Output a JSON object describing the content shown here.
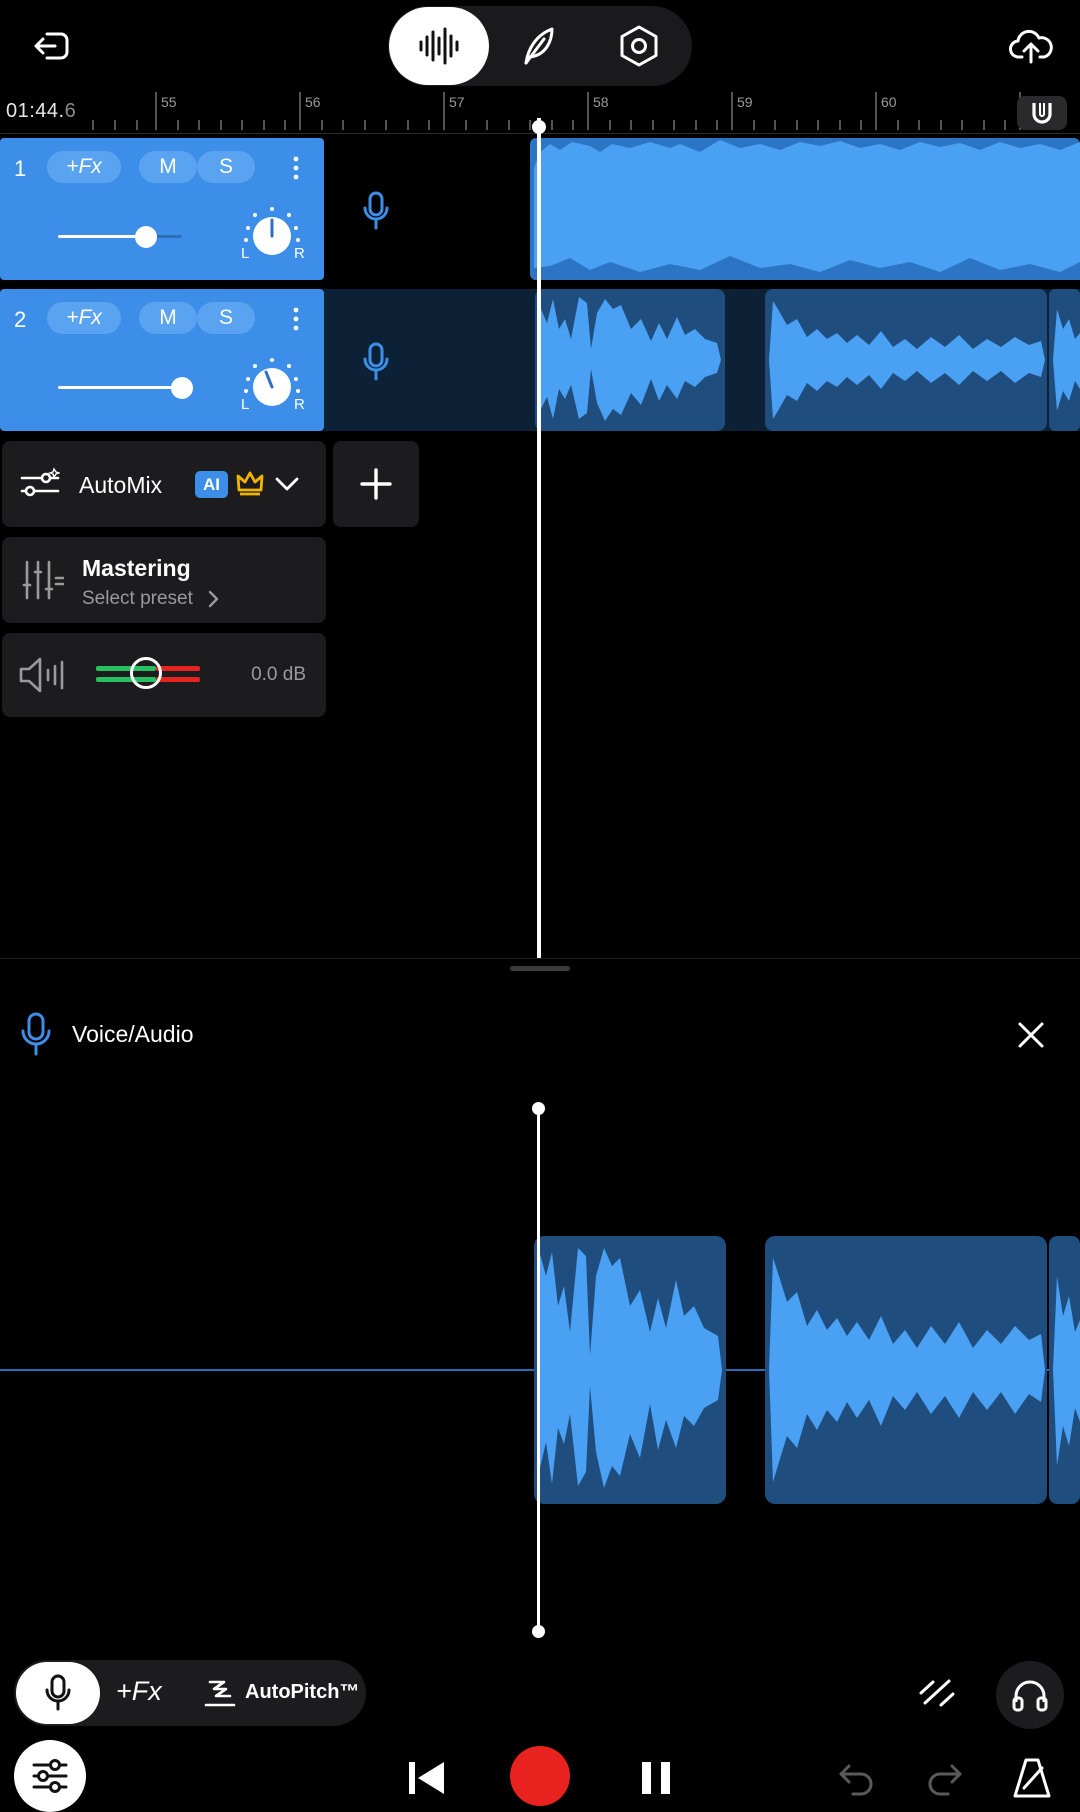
{
  "toolbar": {
    "icons": [
      "back-icon",
      "waveform-icon",
      "feather-icon",
      "settings-hex-icon",
      "cloud-upload-icon"
    ],
    "active_mode": "waveform"
  },
  "ruler": {
    "time_main": "01:44.",
    "time_tenth": "6",
    "marks": [
      "55",
      "56",
      "57",
      "58",
      "59",
      "60"
    ]
  },
  "tracks": [
    {
      "number": "1",
      "fx_label": "+Fx",
      "mute_label": "M",
      "solo_label": "S",
      "volume": 0.75,
      "pan_left": "L",
      "pan_right": "R"
    },
    {
      "number": "2",
      "fx_label": "+Fx",
      "mute_label": "M",
      "solo_label": "S",
      "volume": 1.0,
      "pan_left": "L",
      "pan_right": "R"
    }
  ],
  "automix": {
    "label": "AutoMix",
    "ai_badge": "AI"
  },
  "mastering": {
    "title": "Mastering",
    "subtitle": "Select preset"
  },
  "master_volume": {
    "value": "0.0 dB"
  },
  "editor": {
    "title": "Voice/Audio"
  },
  "bottom_tools": {
    "fx_label": "+Fx",
    "autopitch_label": "AutoPitch™"
  },
  "colors": {
    "accent": "#3d8ee8",
    "record": "#e8221f",
    "clip_bg": "#1f4d7e",
    "background": "#000000"
  }
}
